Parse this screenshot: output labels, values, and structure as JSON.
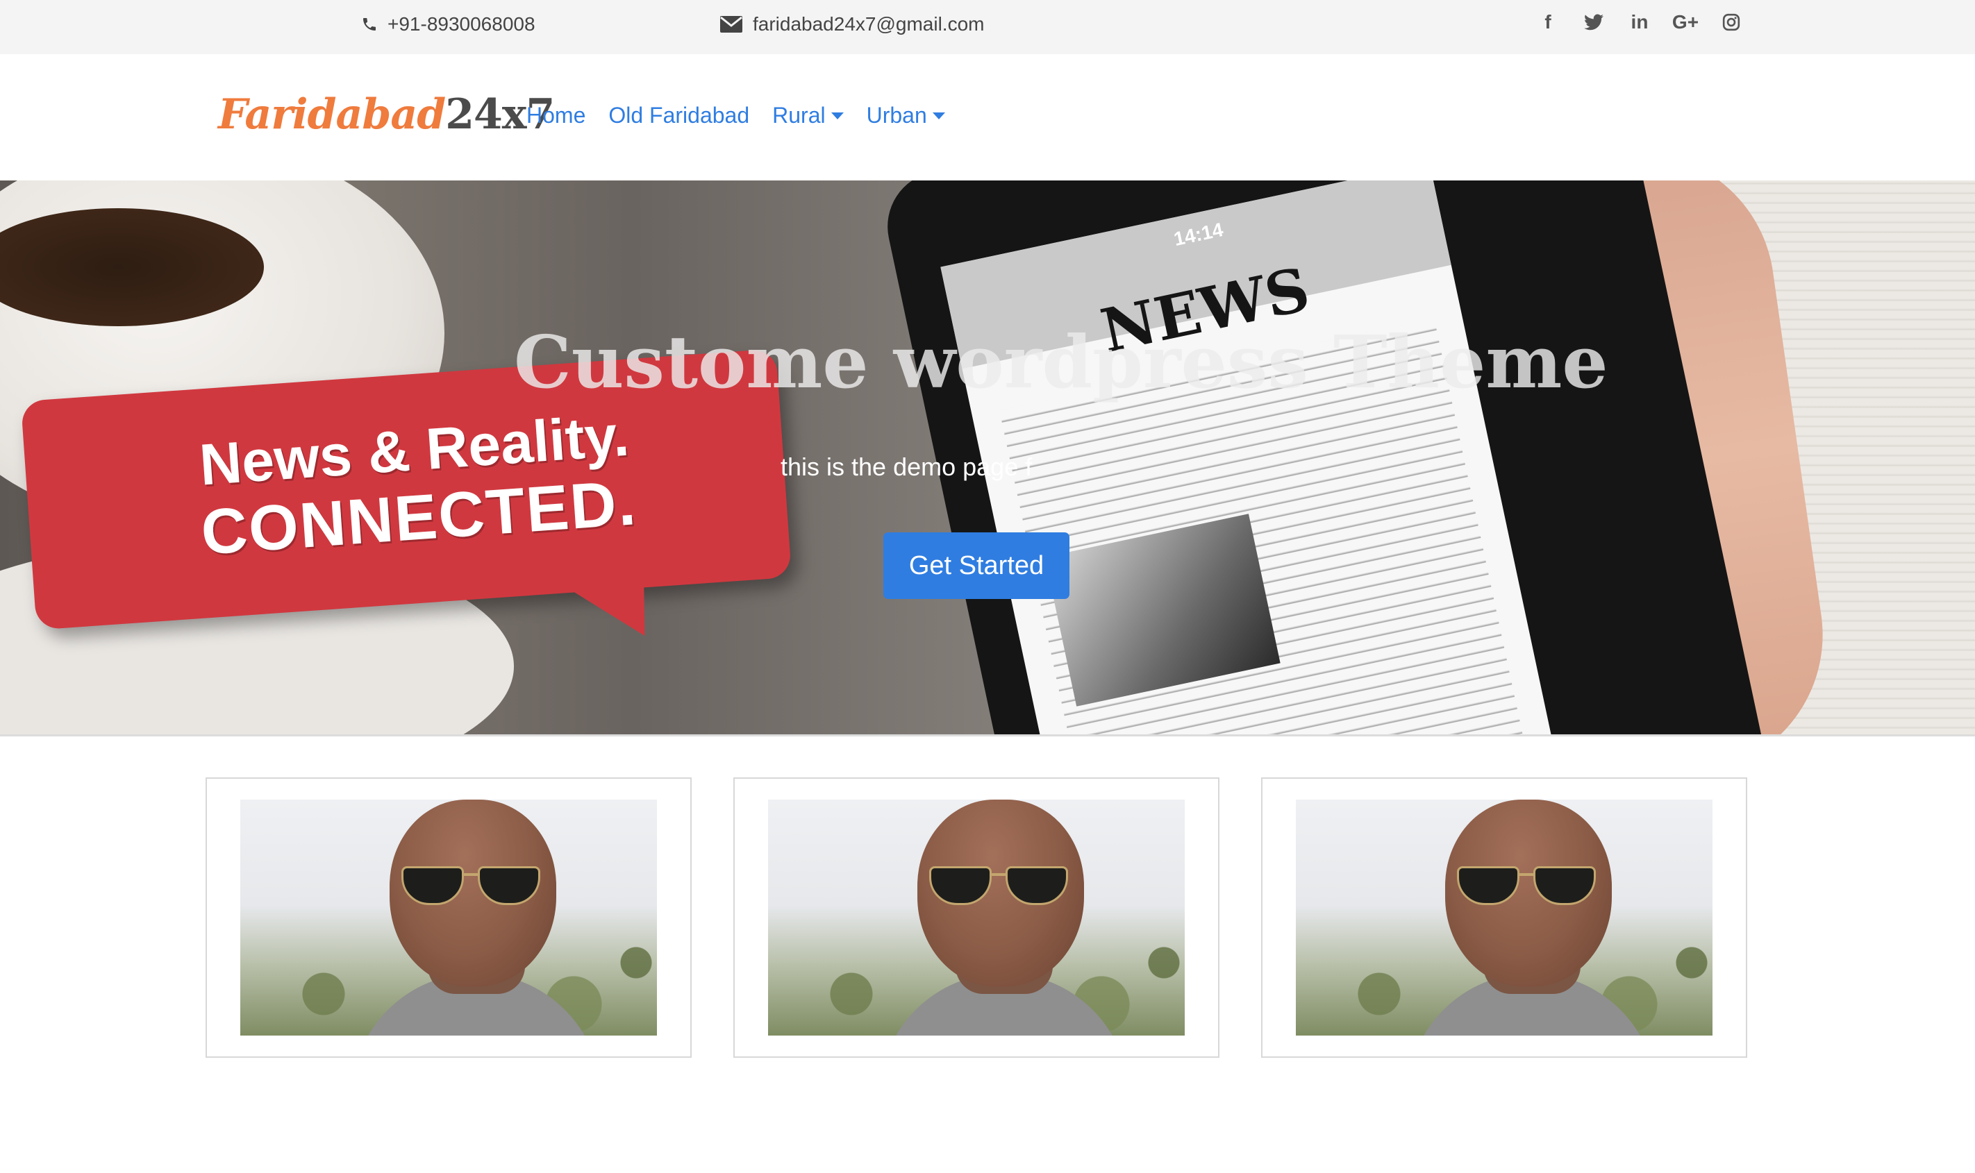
{
  "topbar": {
    "phone": "+91-8930068008",
    "email": "faridabad24x7@gmail.com",
    "social": [
      {
        "icon": "facebook-icon",
        "glyph": "f"
      },
      {
        "icon": "twitter-icon",
        "glyph": "🐦"
      },
      {
        "icon": "linkedin-icon",
        "glyph": "in"
      },
      {
        "icon": "google-plus-icon",
        "glyph": "G+"
      },
      {
        "icon": "instagram-icon",
        "glyph": "◎"
      }
    ]
  },
  "navbar": {
    "logo_part1": "Faridabad",
    "logo_part2": "24x7",
    "links": [
      {
        "label": "Home",
        "dropdown": false
      },
      {
        "label": "Old Faridabad",
        "dropdown": false
      },
      {
        "label": "Rural",
        "dropdown": true
      },
      {
        "label": "Urban",
        "dropdown": true
      }
    ]
  },
  "hero": {
    "title": "Custome wordpress Theme",
    "subtitle": "this is the demo page f",
    "cta_label": "Get Started",
    "bubble_line1": "News & Reality.",
    "bubble_line2": "CONNECTED.",
    "phone_time": "14:14",
    "phone_headline": "NEWS"
  },
  "cards": [
    {
      "image": "man-with-sunglasses"
    },
    {
      "image": "man-with-sunglasses"
    },
    {
      "image": "man-with-sunglasses"
    }
  ],
  "colors": {
    "accent": "#2f7de1",
    "logo_orange": "#ef7b3d",
    "bubble_red": "#d0383f",
    "topbar_bg": "#f4f4f4"
  }
}
